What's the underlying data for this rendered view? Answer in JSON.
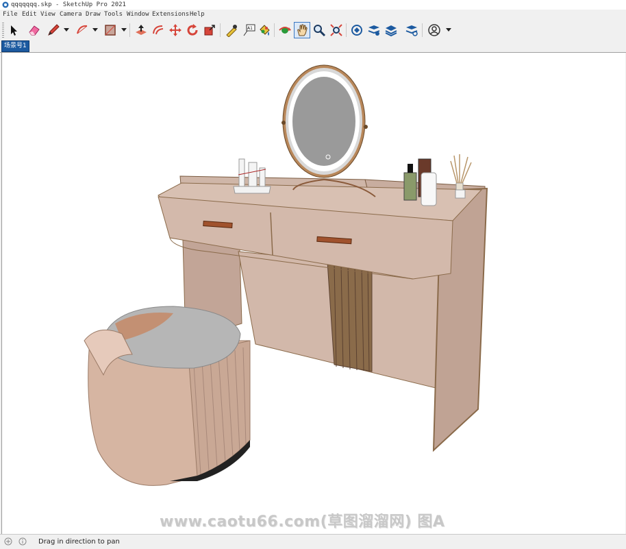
{
  "window": {
    "title": "qqqqqqq.skp - SketchUp Pro 2021"
  },
  "menu": {
    "items": [
      "File",
      "Edit",
      "View",
      "Camera",
      "Draw",
      "Tools",
      "Window",
      "Extensions",
      "Help"
    ]
  },
  "toolbar": {
    "tools": [
      {
        "name": "select-tool",
        "icon": "arrow-cursor-icon"
      },
      {
        "name": "eraser-tool",
        "icon": "eraser-icon"
      },
      {
        "name": "line-tool",
        "icon": "pencil-icon"
      },
      {
        "name": "arc-tool",
        "icon": "arc-icon"
      },
      {
        "name": "shape-tool",
        "icon": "rectangle-icon"
      },
      {
        "name": "push-pull-tool",
        "icon": "push-pull-icon"
      },
      {
        "name": "offset-tool",
        "icon": "offset-icon"
      },
      {
        "name": "move-tool",
        "icon": "move-arrows-icon"
      },
      {
        "name": "rotate-tool",
        "icon": "rotate-icon"
      },
      {
        "name": "scale-tool",
        "icon": "scale-icon"
      },
      {
        "name": "tape-measure-tool",
        "icon": "tape-measure-icon"
      },
      {
        "name": "text-tool",
        "icon": "text-label-icon"
      },
      {
        "name": "paint-bucket-tool",
        "icon": "paint-bucket-icon"
      },
      {
        "name": "orbit-tool",
        "icon": "orbit-icon"
      },
      {
        "name": "pan-tool",
        "icon": "hand-icon"
      },
      {
        "name": "zoom-tool",
        "icon": "magnifier-icon"
      },
      {
        "name": "zoom-extents-tool",
        "icon": "zoom-extents-icon"
      },
      {
        "name": "warehouse-tool",
        "icon": "warehouse-icon"
      },
      {
        "name": "extension-warehouse-tool",
        "icon": "extension-warehouse-icon"
      },
      {
        "name": "layout-tool",
        "icon": "layers-icon"
      },
      {
        "name": "extension-manager-tool",
        "icon": "extension-manager-icon"
      },
      {
        "name": "account-tool",
        "icon": "user-circle-icon"
      }
    ],
    "text_tool_label": "A1"
  },
  "scenes": {
    "tabs": [
      "场景号1"
    ]
  },
  "viewport": {
    "watermark": "www.caotu66.com(草图溜溜网) 图A"
  },
  "status": {
    "text": "Drag in direction to pan"
  },
  "colors": {
    "accent": "#1c5aa0",
    "furniture": "#cdb0a1",
    "wood_trim": "#8a6a4a",
    "mirror_glass": "#9a9a9a"
  }
}
